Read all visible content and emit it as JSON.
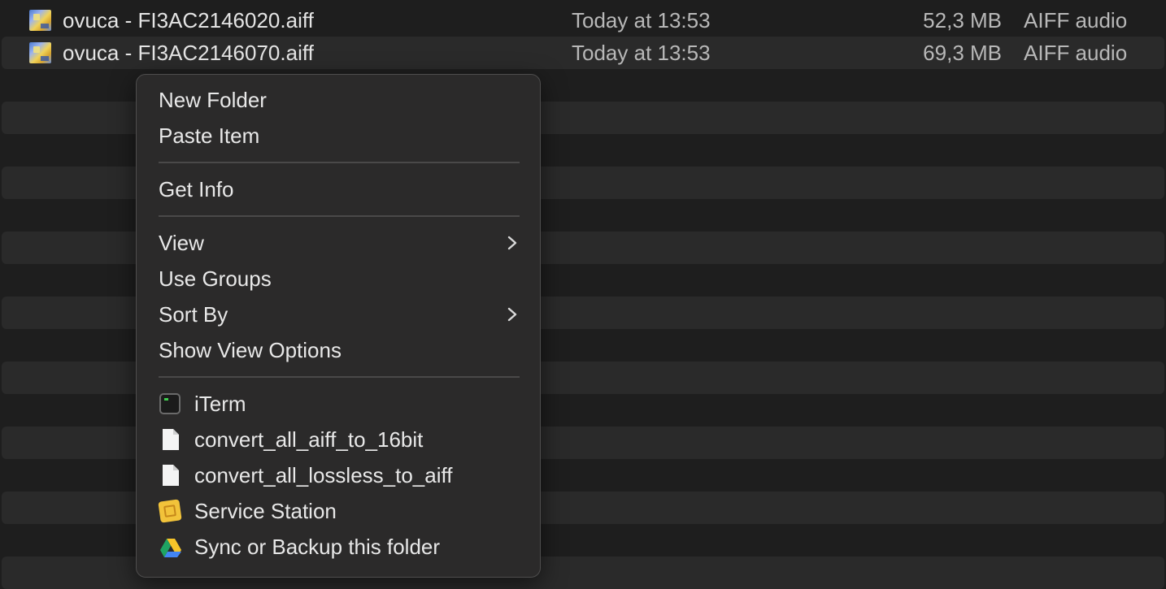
{
  "files": [
    {
      "name": "ovuca - FI3AC2146020.aiff",
      "date": "Today at 13:53",
      "size": "52,3 MB",
      "kind": "AIFF audio"
    },
    {
      "name": "ovuca - FI3AC2146070.aiff",
      "date": "Today at 13:53",
      "size": "69,3 MB",
      "kind": "AIFF audio"
    }
  ],
  "context_menu": {
    "new_folder": "New Folder",
    "paste_item": "Paste Item",
    "get_info": "Get Info",
    "view": "View",
    "use_groups": "Use Groups",
    "sort_by": "Sort By",
    "show_view_options": "Show View Options",
    "iterm": "iTerm",
    "convert_16bit": "convert_all_aiff_to_16bit",
    "convert_lossless": "convert_all_lossless_to_aiff",
    "service_station": "Service Station",
    "sync_backup": "Sync or Backup this folder"
  },
  "icons": {
    "file": "aiff-file-thumbnail-icon",
    "submenu": "chevron-right-icon",
    "iterm": "iterm-icon",
    "script": "document-icon",
    "service_station": "service-station-icon",
    "google_drive": "google-drive-icon"
  },
  "colors": {
    "background": "#1e1e1e",
    "alt_row": "#2a2a2a",
    "menu_bg": "#2b2a2a",
    "separator": "#4a4949",
    "text": "#e8e8e8",
    "secondary_text": "#b8b8b8"
  }
}
